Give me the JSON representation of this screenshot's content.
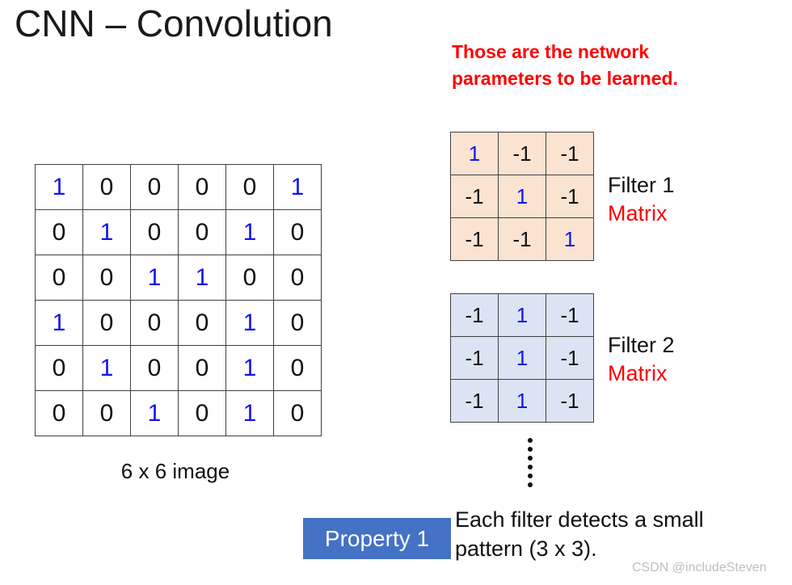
{
  "slide": {
    "title": "CNN – Convolution",
    "red_note_lines": [
      "Those are the network",
      "parameters to be learned."
    ]
  },
  "input_image": {
    "caption": "6 x 6 image",
    "rows": [
      [
        "1",
        "0",
        "0",
        "0",
        "0",
        "1"
      ],
      [
        "0",
        "1",
        "0",
        "0",
        "1",
        "0"
      ],
      [
        "0",
        "0",
        "1",
        "1",
        "0",
        "0"
      ],
      [
        "1",
        "0",
        "0",
        "0",
        "1",
        "0"
      ],
      [
        "0",
        "1",
        "0",
        "0",
        "1",
        "0"
      ],
      [
        "0",
        "0",
        "1",
        "0",
        "1",
        "0"
      ]
    ]
  },
  "filters": [
    {
      "name": "Filter 1",
      "kind": "Matrix",
      "background": "#FAE3D1",
      "rows": [
        [
          "1",
          "-1",
          "-1"
        ],
        [
          "-1",
          "1",
          "-1"
        ],
        [
          "-1",
          "-1",
          "1"
        ]
      ]
    },
    {
      "name": "Filter 2",
      "kind": "Matrix",
      "background": "#DCE4F3",
      "rows": [
        [
          "-1",
          "1",
          "-1"
        ],
        [
          "-1",
          "1",
          "-1"
        ],
        [
          "-1",
          "1",
          "-1"
        ]
      ]
    }
  ],
  "ellipsis": {
    "icon": "vertical-ellipsis-icon",
    "dot_count": 6
  },
  "property": {
    "badge_label": "Property 1",
    "description_lines": [
      "Each filter detects a small",
      "pattern (3 x 3)."
    ]
  },
  "watermark": {
    "text": "CSDN @includeSteven"
  },
  "colors": {
    "one_value": "#1414F0",
    "other_value": "#111111",
    "highlight_red": "#FF0000",
    "badge_blue": "#4472C4",
    "filter1_bg": "#FAE3D1",
    "filter2_bg": "#DCE4F3",
    "grid_line": "#404040"
  }
}
